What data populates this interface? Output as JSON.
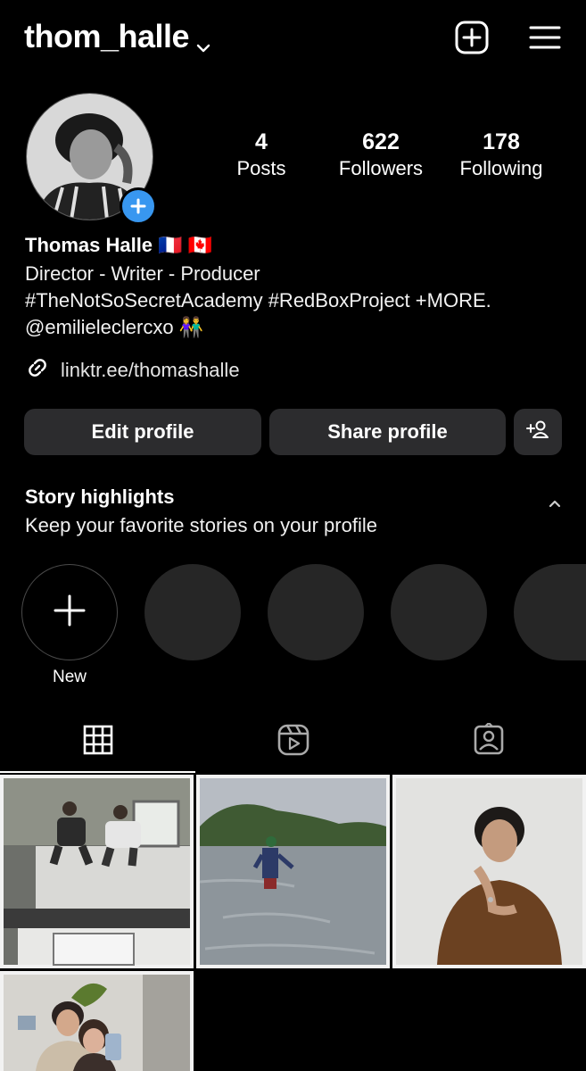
{
  "header": {
    "username": "thom_halle",
    "icons": [
      "chevron-down-icon",
      "create-post-icon",
      "menu-icon"
    ]
  },
  "profile": {
    "stats": [
      {
        "value": "4",
        "label": "Posts"
      },
      {
        "value": "622",
        "label": "Followers"
      },
      {
        "value": "178",
        "label": "Following"
      }
    ],
    "name": "Thomas Halle 🇫🇷 🇨🇦",
    "bio": [
      "Director - Writer - Producer",
      "#TheNotSoSecretAcademy #RedBoxProject +MORE.",
      "@emilieleclercxo 👫"
    ],
    "link": "linktr.ee/thomashalle"
  },
  "actions": {
    "edit": "Edit profile",
    "share": "Share profile"
  },
  "highlights": {
    "title": "Story highlights",
    "subtitle": "Keep your favorite stories on your profile",
    "new_label": "New"
  },
  "tabs": [
    "grid-icon",
    "reels-icon",
    "tagged-icon"
  ],
  "colors": {
    "accent": "#3897f0",
    "button_bg": "#2c2c2e"
  }
}
